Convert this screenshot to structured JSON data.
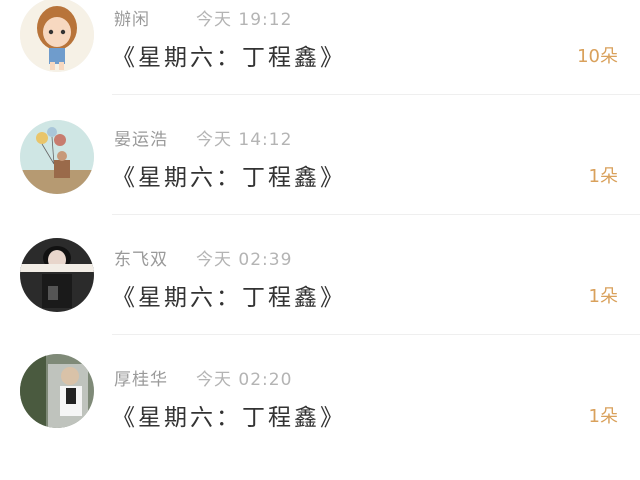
{
  "items": [
    {
      "name": "辦闲",
      "time": "今天 19:12",
      "title": "《星期六：丁程鑫》",
      "count": "10朵",
      "avatar": "cartoon-girl-avatar"
    },
    {
      "name": "晏运浩",
      "time": "今天 14:12",
      "title": "《星期六：丁程鑫》",
      "count": "1朵",
      "avatar": "balloons-person-avatar"
    },
    {
      "name": "东飞双",
      "time": "今天 02:39",
      "title": "《星期六：丁程鑫》",
      "count": "1朵",
      "avatar": "dark-portrait-avatar"
    },
    {
      "name": "厚桂华",
      "time": "今天 02:20",
      "title": "《星期六：丁程鑫》",
      "count": "1朵",
      "avatar": "street-photo-avatar"
    }
  ],
  "colors": {
    "accent": "#d9a15c",
    "name": "#9a9a9a",
    "time": "#b4b4b4",
    "title": "#333333"
  }
}
